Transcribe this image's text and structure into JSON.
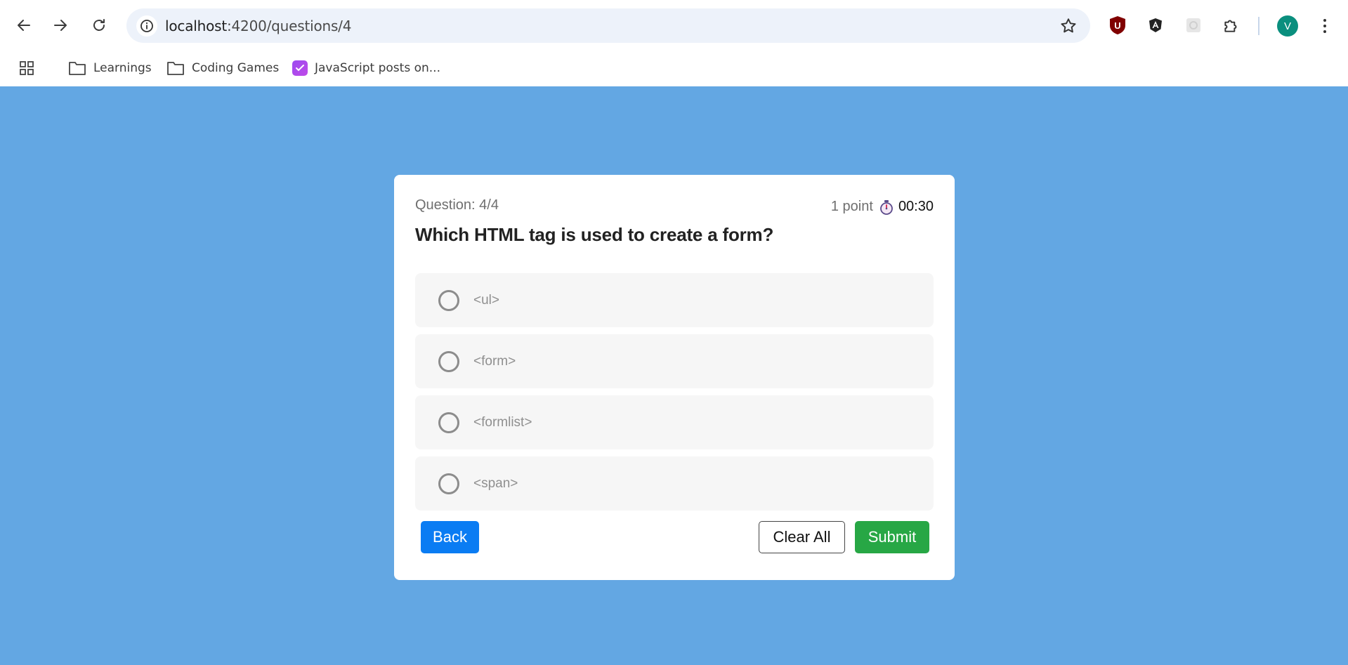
{
  "browser": {
    "url_host": "localhost",
    "url_rest": ":4200/questions/4",
    "profile_initial": "V",
    "bookmarks": [
      {
        "label": "Learnings",
        "icon": "folder-icon"
      },
      {
        "label": "Coding Games",
        "icon": "folder-icon"
      },
      {
        "label": "JavaScript posts on...",
        "icon": "js-posts-icon"
      }
    ],
    "extensions": [
      "ublock-icon",
      "angular-icon",
      "extension-generic-icon",
      "puzzle-icon"
    ]
  },
  "quiz": {
    "question_number": "Question: 4/4",
    "points": "1 point",
    "timer": "00:30",
    "question": "Which HTML tag is used to create a form?",
    "options": [
      "<ul>",
      "<form>",
      "<formlist>",
      "<span>"
    ],
    "buttons": {
      "back": "Back",
      "clear_all": "Clear All",
      "submit": "Submit"
    }
  },
  "colors": {
    "page_background": "#63a7e3",
    "back_button": "#0a7cf3",
    "submit_button": "#27a745"
  }
}
